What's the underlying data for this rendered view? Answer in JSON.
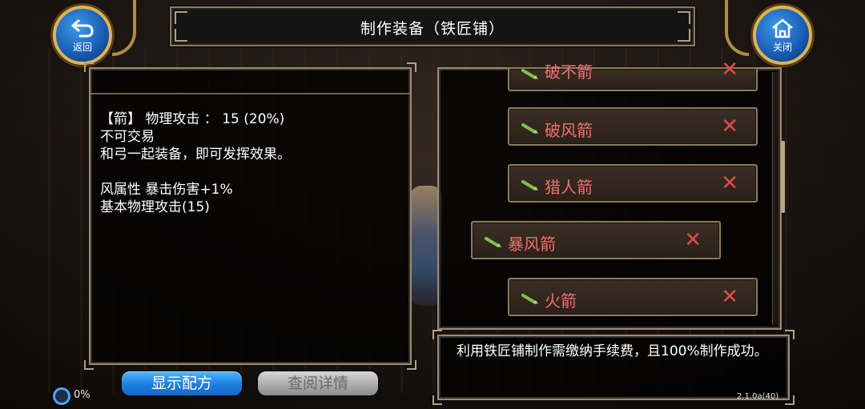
{
  "window": {
    "title": "制作装备（铁匠铺）"
  },
  "nav": {
    "back_label": "返回",
    "close_label": "关闭"
  },
  "detail": {
    "lines": [
      "【箭】 物理攻击 ：  15 (20%)",
      "不可交易",
      "和弓一起装备，即可发挥效果。",
      "",
      "风属性 暴击伤害+1%",
      "基本物理攻击(15)"
    ]
  },
  "recipe_list": {
    "items": [
      {
        "name": "破不箭",
        "selected": false,
        "partial": true
      },
      {
        "name": "破风箭",
        "selected": false,
        "partial": false
      },
      {
        "name": "猎人箭",
        "selected": false,
        "partial": false
      },
      {
        "name": "暴风箭",
        "selected": true,
        "partial": false
      },
      {
        "name": "火箭",
        "selected": false,
        "partial": false
      }
    ],
    "unavailable_mark": "✕"
  },
  "info": {
    "text": "利用铁匠铺制作需缴纳手续费，且100%制作成功。"
  },
  "buttons": {
    "show_recipe": "显示配方",
    "view_details": "查阅详情"
  },
  "status": {
    "loading_percent": "0%",
    "version": "2.1.0a(40)"
  },
  "colors": {
    "item_text": "#f07070",
    "primary_button": "#1e7ee3",
    "disabled_button": "#a9a9a9",
    "frame": "#9a8a72"
  },
  "icons": {
    "back": "back-arrow-icon",
    "close": "home-icon",
    "item": "arrow-icon",
    "remove": "x-icon"
  }
}
